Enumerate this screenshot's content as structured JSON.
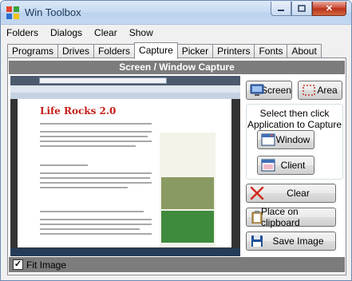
{
  "window": {
    "title": "Win Toolbox",
    "close_glyph": "✕"
  },
  "menu": [
    "Folders",
    "Dialogs",
    "Clear",
    "Show"
  ],
  "tabs": [
    "Programs",
    "Drives",
    "Folders",
    "Capture",
    "Picker",
    "Printers",
    "Fonts",
    "About"
  ],
  "active_tab": "Capture",
  "panel": {
    "header": "Screen / Window Capture"
  },
  "capture_preview": {
    "site_title": "Life Rocks 2.0"
  },
  "buttons": {
    "screen": "Screen",
    "area": "Area",
    "group_text_1": "Select then click",
    "group_text_2": "Application to Capture",
    "window": "Window",
    "client": "Client",
    "clear": "Clear",
    "clipboard": "Place on clipboard",
    "save": "Save Image"
  },
  "options": {
    "fit_image": "Fit Image",
    "fit_image_checked": true,
    "check_glyph": "✓"
  },
  "colors": {
    "panel_header": "#7c7c7c",
    "clear_icon": "#d22a1c",
    "save_icon": "#1f4f9a"
  }
}
